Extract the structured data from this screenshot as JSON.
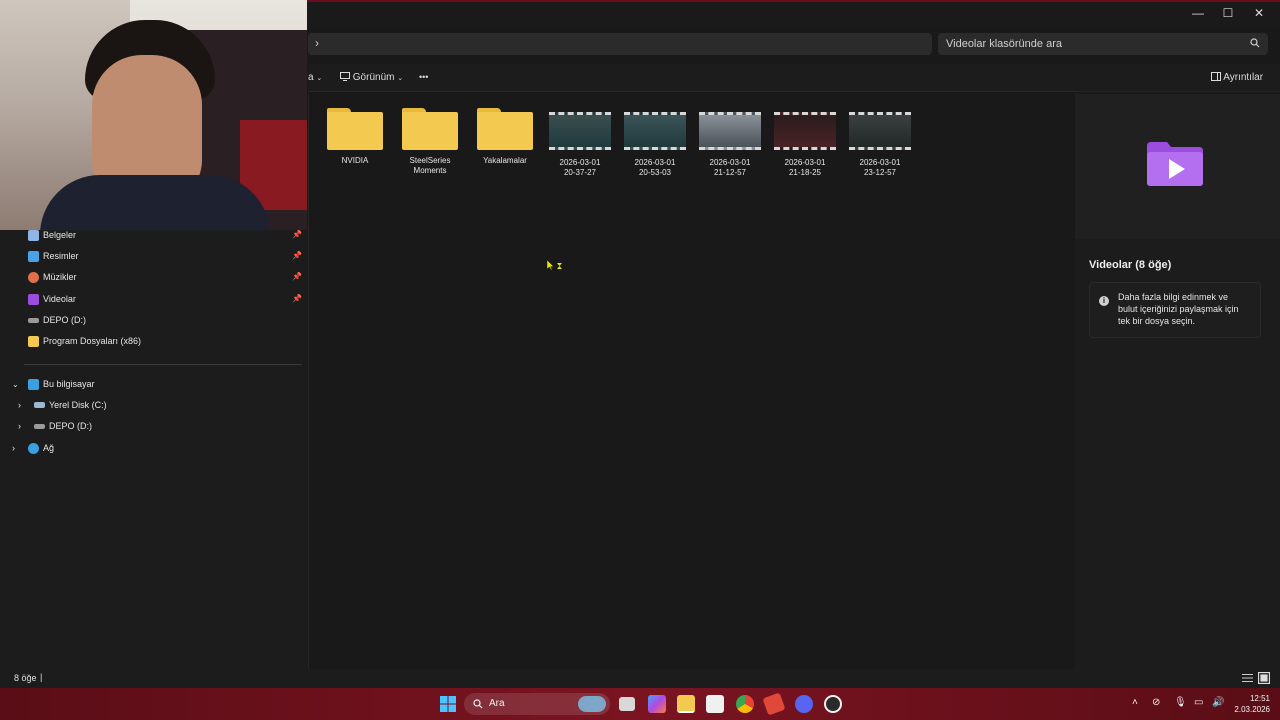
{
  "window": {
    "minimize_glyph": "—",
    "maximize_glyph": "☐",
    "close_glyph": "✕"
  },
  "address": {
    "chevron": "›"
  },
  "search": {
    "placeholder": "Videolar klasöründe ara"
  },
  "toolbar": {
    "sort_fragment": "a",
    "view_label": "Görünüm",
    "more_label": "•••",
    "details_label": "Ayrıntılar"
  },
  "sidebar": {
    "quick_access": [
      {
        "label": "Belgeler",
        "icon": "documents-icon",
        "pinned": true
      },
      {
        "label": "Resimler",
        "icon": "pictures-icon",
        "pinned": true
      },
      {
        "label": "Müzikler",
        "icon": "music-icon",
        "pinned": true
      },
      {
        "label": "Videolar",
        "icon": "videos-icon",
        "pinned": true
      },
      {
        "label": "DEPO (D:)",
        "icon": "drive-icon",
        "pinned": false
      },
      {
        "label": "Program Dosyaları (x86)",
        "icon": "folder-icon",
        "pinned": false
      }
    ],
    "this_pc": {
      "label": "Bu bilgisayar",
      "expanded": true
    },
    "drives": [
      {
        "label": "Yerel Disk (C:)",
        "icon": "drive-icon"
      },
      {
        "label": "DEPO (D:)",
        "icon": "drive-icon"
      }
    ],
    "network": {
      "label": "Ağ"
    }
  },
  "items": [
    {
      "name_line1": "NVIDIA",
      "name_line2": "",
      "type": "folder"
    },
    {
      "name_line1": "SteelSeries",
      "name_line2": "Moments",
      "type": "folder"
    },
    {
      "name_line1": "Yakalamalar",
      "name_line2": "",
      "type": "folder"
    },
    {
      "name_line1": "2026-03-01",
      "name_line2": "20-37-27",
      "type": "video"
    },
    {
      "name_line1": "2026-03-01",
      "name_line2": "20-53-03",
      "type": "video"
    },
    {
      "name_line1": "2026-03-01",
      "name_line2": "21-12-57",
      "type": "video"
    },
    {
      "name_line1": "2026-03-01",
      "name_line2": "21-18-25",
      "type": "video"
    },
    {
      "name_line1": "2026-03-01",
      "name_line2": "23-12-57",
      "type": "video"
    }
  ],
  "details": {
    "title": "Videolar (8 öğe)",
    "info_line1": "Daha fazla bilgi edinmek ve",
    "info_line2": "bulut içeriğinizi paylaşmak için",
    "info_line3": "tek bir dosya seçin."
  },
  "status": {
    "count": "8 öğe",
    "separator": "|"
  },
  "taskbar": {
    "search_label": "Ara",
    "time": "12:51",
    "date": "2.03.2026"
  },
  "colors": {
    "taskbar": "#7a1421",
    "folder": "#f3c94f",
    "video_icon": "#9b4de0"
  }
}
